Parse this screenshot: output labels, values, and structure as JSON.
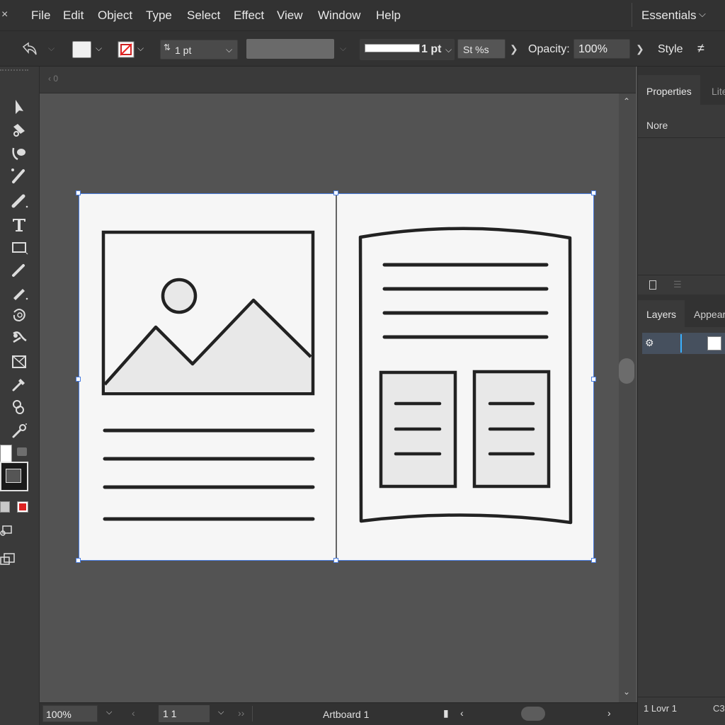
{
  "menubar": {
    "close_glyph": "×",
    "items": [
      "File",
      "Edit",
      "Object",
      "Type",
      "Select",
      "Effect",
      "View",
      "Window",
      "Help"
    ],
    "workspace_label": "Essentials"
  },
  "controlbar": {
    "stroke_weight": "1 pt",
    "brush_weight": "1 pt",
    "style_label": "St %s",
    "opacity_label": "Opacity:",
    "opacity_value": "100%",
    "style_button_label": "Style"
  },
  "tabstrip": {
    "label": "0"
  },
  "panels": {
    "properties": {
      "tab_active": "Properties",
      "tab_inactive": "Lite",
      "selection_text": "Nore"
    },
    "layers": {
      "tab_active": "Layers",
      "tab_inactive": "Appear",
      "footer_text": "1 Lovr 1",
      "footer_right": "C3"
    }
  },
  "statusbar": {
    "zoom": "100%",
    "page_field": "1 1",
    "artboard_label": "Artboard 1"
  },
  "colors": {
    "selection_accent": "#4a7de0",
    "layer_accent": "#3ab0ff",
    "illustration_stroke": "#222222",
    "illustration_fill": "#e8e8e8"
  },
  "icons": [
    "close-icon",
    "chevron-down-icon",
    "selection-tool-icon",
    "direct-selection-icon",
    "curvature-icon",
    "paintbrush-icon",
    "pencil-icon",
    "type-tool-icon",
    "rectangle-tool-icon",
    "shaper-icon",
    "eraser-icon",
    "rotate-icon",
    "warp-icon",
    "free-transform-icon",
    "eyedropper-icon",
    "blend-icon",
    "symbol-sprayer-icon",
    "fill-swatch-icon",
    "stroke-swatch-icon",
    "visibility-icon",
    "scroll-up-icon",
    "scroll-down-icon"
  ]
}
